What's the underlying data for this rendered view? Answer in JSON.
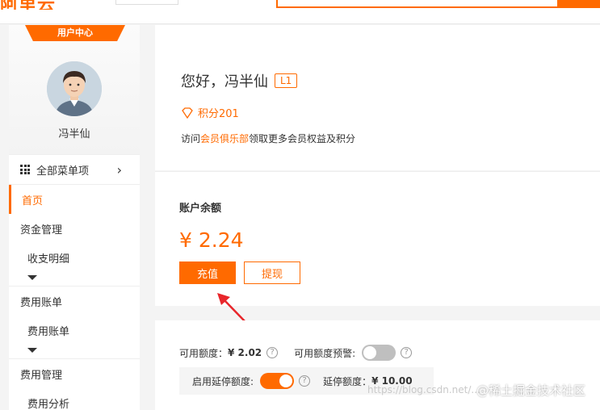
{
  "header": {
    "logo_text": "阿里云"
  },
  "sidebar": {
    "banner": "用户中心",
    "username": "冯半仙",
    "all_menu_label": "全部菜单项",
    "items": [
      {
        "label": "首页"
      },
      {
        "label": "资金管理"
      },
      {
        "label": "收支明细"
      },
      {
        "label": "费用账单"
      },
      {
        "label": "费用账单"
      },
      {
        "label": "费用管理"
      },
      {
        "label": "费用分析"
      }
    ]
  },
  "welcome": {
    "greeting": "您好，冯半仙",
    "level": "L1",
    "points": "积分201",
    "club_prefix": "访问",
    "club_link": "会员俱乐部",
    "club_suffix": "领取更多会员权益及积分"
  },
  "balance": {
    "title": "账户余额",
    "amount": "¥ 2.24",
    "recharge_label": "充值",
    "withdraw_label": "提现"
  },
  "credit": {
    "available_label": "可用额度：",
    "available_value": "¥ 2.02",
    "warning_label": "可用额度预警:",
    "warning_enabled": false,
    "deferral_label": "启用延停额度:",
    "deferral_enabled": true,
    "deferral_amount_label": "延停额度：",
    "deferral_amount_value": "¥ 10.00"
  },
  "watermark": {
    "url": "https://blog.csdn.net/...",
    "brand": "@稀土掘金技术社区"
  },
  "colors": {
    "accent": "#ff6a00",
    "toggle_off": "#bfbfbf",
    "arrow": "#e8262b"
  }
}
